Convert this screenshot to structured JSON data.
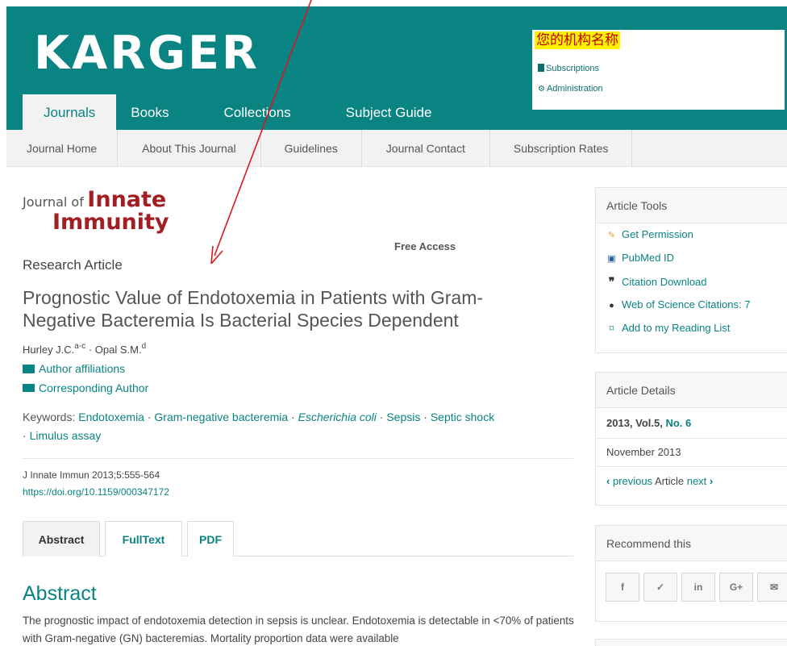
{
  "brand": {
    "name": "KARGER"
  },
  "institution": {
    "name": "您的机构名称",
    "links": [
      "Subscriptions",
      "Administration"
    ]
  },
  "nav": {
    "tabs": [
      "Journals",
      "Books",
      "Collections",
      "Subject Guide"
    ],
    "active": "Journals"
  },
  "subnav": [
    "Journal Home",
    "About This Journal",
    "Guidelines",
    "Journal Contact",
    "Subscription Rates"
  ],
  "journal": {
    "line1_small": "Journal of",
    "line1_big": "Innate",
    "line2": "Immunity"
  },
  "article": {
    "access": "Free Access",
    "type": "Research Article",
    "title": "Prognostic Value of Endotoxemia in Patients with Gram-Negative Bacteremia Is Bacterial Species Dependent",
    "author1": "Hurley J.C.",
    "author1_sup": "a-c",
    "separator": " · ",
    "author2": "Opal S.M.",
    "author2_sup": "d",
    "affiliations_link": "Author affiliations",
    "corresponding_link": "Corresponding Author",
    "keywords_label": "Keywords: ",
    "keywords": [
      "Endotoxemia",
      "Gram-negative bacteremia",
      "Escherichia coli",
      "Sepsis",
      "Septic shock",
      "Limulus assay"
    ],
    "citation": "J Innate Immun 2013;5:555-564",
    "doi": "https://doi.org/10.1159/000347172"
  },
  "content_tabs": [
    "Abstract",
    "FullText",
    "PDF"
  ],
  "abstract": {
    "heading": "Abstract",
    "text": "The prognostic impact of endotoxemia detection in sepsis is unclear. Endotoxemia is detectable in <70% of patients with Gram-negative (GN) bacteremias. Mortality proportion data were available"
  },
  "sidebar": {
    "tools_title": "Article Tools",
    "tools": [
      {
        "label": "Get Permission",
        "icon": "permission-icon"
      },
      {
        "label": "PubMed ID",
        "icon": "pubmed-icon"
      },
      {
        "label": "Citation Download",
        "icon": "quote-icon"
      },
      {
        "label": "Web of Science Citations: 7",
        "icon": "globe-icon"
      },
      {
        "label": "Add to my Reading List",
        "icon": "bookmark-icon"
      }
    ],
    "details_title": "Article Details",
    "details_year_vol": "2013, Vol.5, ",
    "details_issue": "No. 6",
    "details_date": "November 2013",
    "prev_label": "previous",
    "article_word": " Article ",
    "next_label": "next",
    "recommend_title": "Recommend this",
    "share_icons": [
      "facebook-icon",
      "twitter-icon",
      "linkedin-icon",
      "google-plus-icon",
      "email-icon"
    ]
  },
  "colors": {
    "brand": "#0a8383",
    "journal_red": "#a31e22",
    "highlight": "#fff200",
    "arrow": "#d7191c"
  }
}
